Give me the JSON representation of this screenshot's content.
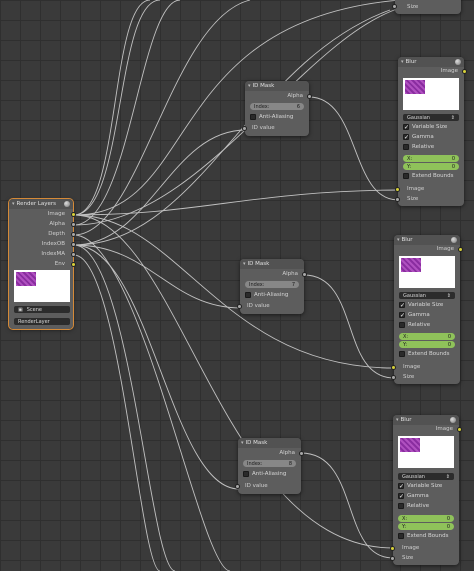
{
  "render_layers": {
    "title": "Render Layers",
    "outputs": [
      "Image",
      "Alpha",
      "Depth",
      "IndexOB",
      "IndexMA",
      "Env"
    ],
    "scene": "Scene",
    "layer": "RenderLayer"
  },
  "id_masks": [
    {
      "title": "ID Mask",
      "alpha": "Alpha",
      "index_label": "Index:",
      "index_value": "6",
      "anti": "Anti-Aliasing",
      "id_value": "ID value"
    },
    {
      "title": "ID Mask",
      "alpha": "Alpha",
      "index_label": "Index:",
      "index_value": "7",
      "anti": "Anti-Aliasing",
      "id_value": "ID value"
    },
    {
      "title": "ID Mask",
      "alpha": "Alpha",
      "index_label": "Index:",
      "index_value": "8",
      "anti": "Anti-Aliasing",
      "id_value": "ID value"
    }
  ],
  "blurs": [
    {
      "title": "Blur",
      "image_out": "Image",
      "filter": "Gaussian",
      "variable_size": "Variable Size",
      "gamma": "Gamma",
      "relative": "Relative",
      "x_label": "X:",
      "x_value": "0",
      "y_label": "Y:",
      "y_value": "0",
      "extend": "Extend Bounds",
      "image_in": "Image",
      "size_in": "Size"
    },
    {
      "title": "Blur",
      "image_out": "Image",
      "filter": "Gaussian",
      "variable_size": "Variable Size",
      "gamma": "Gamma",
      "relative": "Relative",
      "x_label": "X:",
      "x_value": "0",
      "y_label": "Y:",
      "y_value": "0",
      "extend": "Extend Bounds",
      "image_in": "Image",
      "size_in": "Size"
    },
    {
      "title": "Blur",
      "image_out": "Image",
      "filter": "Gaussian",
      "variable_size": "Variable Size",
      "gamma": "Gamma",
      "relative": "Relative",
      "x_label": "X:",
      "x_value": "0",
      "y_label": "Y:",
      "y_value": "0",
      "extend": "Extend Bounds",
      "image_in": "Image",
      "size_in": "Size"
    }
  ],
  "top_partial": {
    "size": "Size"
  },
  "colors": {
    "socket_image": "#d7d13a",
    "socket_value": "#a8a8a8",
    "wire": "#d0d0d0",
    "active_outline": "#d58a38",
    "checked_field": "#8fc25a"
  }
}
